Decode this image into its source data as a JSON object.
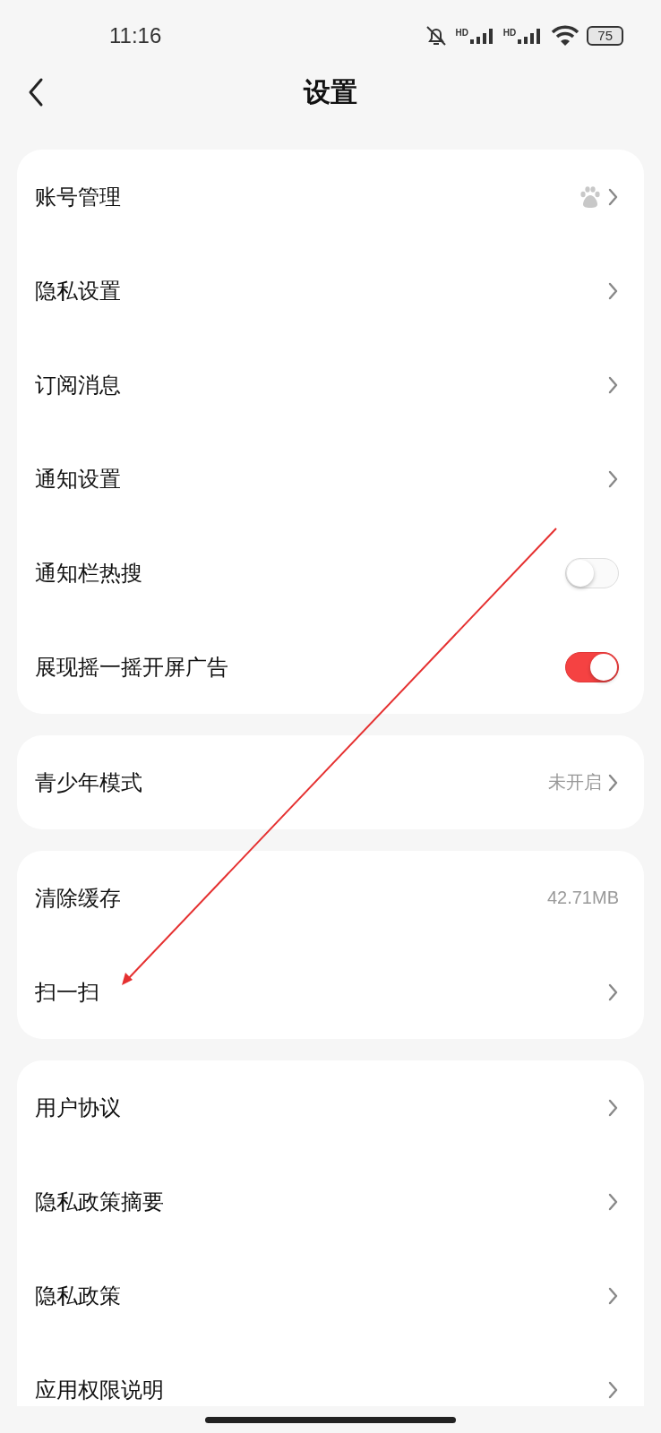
{
  "status_bar": {
    "time": "11:16",
    "battery": "75",
    "signal_labels": [
      "HD",
      "HD"
    ]
  },
  "header": {
    "title": "设置"
  },
  "groups": [
    {
      "items": [
        {
          "kind": "account",
          "label": "账号管理"
        },
        {
          "kind": "link",
          "label": "隐私设置"
        },
        {
          "kind": "link",
          "label": "订阅消息"
        },
        {
          "kind": "link",
          "label": "通知设置"
        },
        {
          "kind": "toggle",
          "label": "通知栏热搜",
          "on": false
        },
        {
          "kind": "toggle",
          "label": "展现摇一摇开屏广告",
          "on": true
        }
      ]
    },
    {
      "items": [
        {
          "kind": "link",
          "label": "青少年模式",
          "value": "未开启"
        }
      ]
    },
    {
      "items": [
        {
          "kind": "value",
          "label": "清除缓存",
          "value": "42.71MB"
        },
        {
          "kind": "link",
          "label": "扫一扫"
        }
      ]
    },
    {
      "items": [
        {
          "kind": "link",
          "label": "用户协议"
        },
        {
          "kind": "link",
          "label": "隐私政策摘要"
        },
        {
          "kind": "link",
          "label": "隐私政策"
        },
        {
          "kind": "link",
          "label": "应用权限说明"
        }
      ]
    }
  ],
  "annotation": {
    "kind": "arrow"
  }
}
